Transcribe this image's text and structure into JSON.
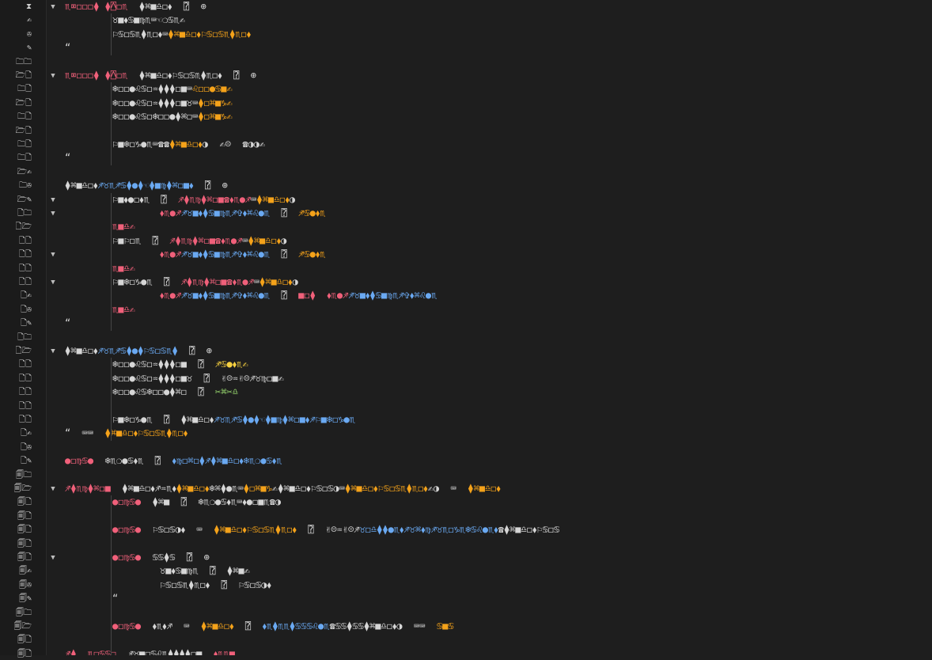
{
  "colors": {
    "background": "#1e1e1e",
    "red": "#f0607a",
    "orange": "#f4a21a",
    "blue": "#6aa9f2",
    "white": "#d6d6d6",
    "yellow": "#f6d040",
    "green": "#9bdd70"
  },
  "gutter": [
    {
      "glyph": "⧗",
      "fold": "▼"
    },
    {
      "glyph": "✍"
    },
    {
      "glyph": "✇"
    },
    {
      "glyph": "✎"
    },
    {
      "glyph": "🗀🗀"
    },
    {
      "glyph": "🗁🗋",
      "fold": "▼"
    },
    {
      "glyph": "🗀🗋"
    },
    {
      "glyph": "🗁🗋"
    },
    {
      "glyph": "🗀🗋"
    },
    {
      "glyph": "🗁🗋"
    },
    {
      "glyph": "🗀🗋"
    },
    {
      "glyph": "🗀🗋"
    },
    {
      "glyph": "🗁✍"
    },
    {
      "glyph": "🗀✇"
    },
    {
      "glyph": "🗁✎",
      "fold": "▼"
    },
    {
      "glyph": "🗋🗀",
      "fold": "▼"
    },
    {
      "glyph": "🗋🗁"
    },
    {
      "glyph": "🗋🗋"
    },
    {
      "glyph": "🗋🗋",
      "fold": "▼"
    },
    {
      "glyph": "🗋🗋"
    },
    {
      "glyph": "🗋🗋",
      "fold": "▼"
    },
    {
      "glyph": "🗋✍"
    },
    {
      "glyph": "🗋✇"
    },
    {
      "glyph": "🗋✎"
    },
    {
      "glyph": "🗋🗀"
    },
    {
      "glyph": "🗋🗁",
      "fold": "▼"
    },
    {
      "glyph": "🗋🗋"
    },
    {
      "glyph": "🗋🗋"
    },
    {
      "glyph": "🗋🗋"
    },
    {
      "glyph": "🗋🗋"
    },
    {
      "glyph": "🗋🗋"
    },
    {
      "glyph": "🗋✍"
    },
    {
      "glyph": "🗋✇"
    },
    {
      "glyph": "🗋✎"
    },
    {
      "glyph": "🗐🗀"
    },
    {
      "glyph": "🗐🗁",
      "fold": "▼"
    },
    {
      "glyph": "🗐🗋"
    },
    {
      "glyph": "🗐🗋"
    },
    {
      "glyph": "🗐🗋"
    },
    {
      "glyph": "🗐🗋"
    },
    {
      "glyph": "🗐🗋",
      "fold": "▼"
    },
    {
      "glyph": "🗐✍"
    },
    {
      "glyph": "🗐✇"
    },
    {
      "glyph": "🗐✎"
    },
    {
      "glyph": "🗐🗀"
    },
    {
      "glyph": "🗐🗁"
    },
    {
      "glyph": "🗐🗋"
    },
    {
      "glyph": "🗐🗋"
    }
  ],
  "lines": [
    {
      "indent": 0,
      "tokens": [
        [
          "red",
          "♏︎⌧︎◻︎◻︎◻︎⧫︎ ⧫︎⍓︎◻︎♏︎"
        ],
        [
          "white",
          "  ⧫︎⌘︎■︎♎︎◻︎⬧︎  ⍰︎  ⊕︎"
        ]
      ]
    },
    {
      "indent": 1,
      "tokens": [
        [
          "white",
          "♉︎■︎⬧︎♋︎■︎♍︎♏︎⌨︎☜︎❍︎♋︎♏︎✍︎"
        ]
      ]
    },
    {
      "indent": 1,
      "tokens": [
        [
          "white",
          "⚐︎♋︎◻︎♋︎♏︎⧫︎♏︎◻︎⬧︎⌨︎"
        ],
        [
          "orange",
          "⧫︎⌘︎■︎♎︎◻︎⬧︎⚐︎♋︎◻︎♋︎♏︎⧫︎♏︎◻︎⬧︎"
        ]
      ]
    },
    {
      "indent": 0,
      "tokens": [
        [
          "white",
          "“"
        ]
      ]
    },
    {
      "indent": 0,
      "tokens": []
    },
    {
      "indent": 0,
      "tokens": [
        [
          "red",
          "♏︎⌧︎◻︎◻︎◻︎⧫︎ ⧫︎⍓︎◻︎♏︎"
        ],
        [
          "white",
          "  ⧫︎⌘︎■︎♎︎◻︎⬧︎⚐︎♋︎◻︎♋︎♏︎⧫︎♏︎◻︎⬧︎  ⍰︎  ⊕︎"
        ]
      ]
    },
    {
      "indent": 1,
      "tokens": [
        [
          "white",
          "❄︎◻︎◻︎●︎♌︎♋︎◻︎♒︎⧫︎⧫︎⧫︎◻︎■︎⌨︎"
        ],
        [
          "orange",
          "♌︎◻︎◻︎●︎♋︎■︎✍︎"
        ]
      ]
    },
    {
      "indent": 1,
      "tokens": [
        [
          "white",
          "❄︎◻︎◻︎●︎♌︎♋︎◻︎♒︎⧫︎⧫︎⧫︎◻︎■︎♉︎⌨︎"
        ],
        [
          "orange",
          "⧫︎◻︎⌘︎■︎♑︎✍︎"
        ]
      ]
    },
    {
      "indent": 1,
      "tokens": [
        [
          "white",
          "❄︎◻︎◻︎●︎♌︎♋︎◻︎❄︎◻︎◻︎●︎⧫︎⌘︎◻︎⌨︎"
        ],
        [
          "orange",
          "⧫︎◻︎⌘︎■︎♑︎✍︎"
        ]
      ]
    },
    {
      "indent": 1,
      "tokens": []
    },
    {
      "indent": 1,
      "tokens": [
        [
          "white",
          "⚐︎■︎❄︎◻︎♑︎●︎♏︎⌨︎☎︎☎︎"
        ],
        [
          "orange",
          "⧫︎⌘︎■︎♎︎◻︎⬧︎"
        ],
        [
          "white",
          "◑︎  ✍︎☹︎  ☎︎◑︎◑︎✍︎"
        ]
      ]
    },
    {
      "indent": 0,
      "tokens": [
        [
          "white",
          "“"
        ]
      ]
    },
    {
      "indent": 0,
      "tokens": []
    },
    {
      "indent": 0,
      "tokens": [
        [
          "white",
          "⧫︎⌘︎■︎♎︎◻︎⬧︎"
        ],
        [
          "blue",
          "♐︎♉︎♏︎♐︎♋︎⧫︎●︎⧫︎☜︎⧫︎■︎♍︎⧫︎⌘︎◻︎■︎⬧︎"
        ],
        [
          "white",
          "  ⍰︎  ⊕︎"
        ]
      ]
    },
    {
      "indent": 1,
      "tokens": [
        [
          "white",
          "⚐︎■︎⬧︎●︎◻︎⬧︎♏︎  ⍰︎  "
        ],
        [
          "red",
          "♐︎⧫︎♏︎♍︎⧫︎⌘︎◻︎■︎☎︎⬧︎♏︎●︎♐︎"
        ],
        [
          "white",
          "⌨︎"
        ],
        [
          "orange",
          "⧫︎⌘︎■︎♎︎◻︎⬧︎"
        ],
        [
          "white",
          "◑︎"
        ]
      ]
    },
    {
      "indent": 2,
      "tokens": [
        [
          "red",
          "⬧︎♏︎●︎♐︎"
        ],
        [
          "blue",
          "♐︎♉︎■︎⬧︎⧫︎♋︎■︎♍︎♏︎♐︎✞︎⬧︎⌘︎♌︎●︎♏︎"
        ],
        [
          "white",
          "  ⍰︎  "
        ],
        [
          "orange",
          "♐︎♋︎●︎⬧︎♏︎"
        ]
      ]
    },
    {
      "indent": 1,
      "tokens": [
        [
          "red",
          "♏︎■︎♎︎✍︎"
        ]
      ]
    },
    {
      "indent": 1,
      "tokens": [
        [
          "white",
          "⚐︎■︎⚐︎◻︎♏︎  ⍰︎  "
        ],
        [
          "red",
          "♐︎⧫︎♏︎♍︎⧫︎⌘︎◻︎■︎☎︎⬧︎♏︎●︎♐︎"
        ],
        [
          "white",
          "⌨︎"
        ],
        [
          "orange",
          "⧫︎⌘︎■︎♎︎◻︎⬧︎"
        ],
        [
          "white",
          "◑︎"
        ]
      ]
    },
    {
      "indent": 2,
      "tokens": [
        [
          "red",
          "⬧︎♏︎●︎♐︎"
        ],
        [
          "blue",
          "♐︎♉︎■︎⬧︎⧫︎♋︎■︎♍︎♏︎♐︎✞︎⬧︎⌘︎♌︎●︎♏︎"
        ],
        [
          "white",
          "  ⍰︎  "
        ],
        [
          "orange",
          "♐︎♋︎●︎⬧︎♏︎"
        ]
      ]
    },
    {
      "indent": 1,
      "tokens": [
        [
          "red",
          "♏︎■︎♎︎✍︎"
        ]
      ]
    },
    {
      "indent": 1,
      "tokens": [
        [
          "white",
          "⚐︎■︎❄︎◻︎♑︎●︎♏︎  ⍰︎  "
        ],
        [
          "red",
          "♐︎⧫︎♏︎♍︎⧫︎⌘︎◻︎■︎☎︎⬧︎♏︎●︎♐︎"
        ],
        [
          "white",
          "⌨︎"
        ],
        [
          "orange",
          "⧫︎⌘︎■︎♎︎◻︎⬧︎"
        ],
        [
          "white",
          "◑︎"
        ]
      ]
    },
    {
      "indent": 2,
      "tokens": [
        [
          "red",
          "⬧︎♏︎●︎♐︎"
        ],
        [
          "blue",
          "♐︎♉︎■︎⬧︎⧫︎♋︎■︎♍︎♏︎♐︎✞︎⬧︎⌘︎♌︎●︎♏︎"
        ],
        [
          "white",
          "  ⍰︎  "
        ],
        [
          "red",
          "■︎◻︎⧫︎  ⬧︎♏︎●︎♐︎"
        ],
        [
          "blue",
          "♐︎♉︎■︎⬧︎⧫︎♋︎■︎♍︎♏︎♐︎✞︎⬧︎⌘︎♌︎●︎♏︎"
        ]
      ]
    },
    {
      "indent": 1,
      "tokens": [
        [
          "red",
          "♏︎■︎♎︎✍︎"
        ]
      ]
    },
    {
      "indent": 0,
      "tokens": [
        [
          "white",
          "“"
        ]
      ]
    },
    {
      "indent": 0,
      "tokens": []
    },
    {
      "indent": 0,
      "tokens": [
        [
          "white",
          "⧫︎⌘︎■︎♎︎◻︎⬧︎"
        ],
        [
          "blue",
          "♐︎♉︎♏︎♐︎♋︎⧫︎●︎⧫︎⚐︎♋︎◻︎♋︎♏︎⧫︎"
        ],
        [
          "white",
          "  ⍰︎  ⊕︎"
        ]
      ]
    },
    {
      "indent": 1,
      "tokens": [
        [
          "white",
          "❄︎◻︎◻︎●︎♌︎♋︎◻︎♒︎⧫︎⧫︎⧫︎◻︎■︎  ⍰︎  "
        ],
        [
          "yellow",
          "♐︎♋︎●︎⬧︎♏︎✍︎"
        ]
      ]
    },
    {
      "indent": 1,
      "tokens": [
        [
          "white",
          "❄︎◻︎◻︎●︎♌︎♋︎◻︎♒︎⧫︎⧫︎⧫︎◻︎■︎♉︎  ⍰︎  ✌︎☹︎♒︎✌︎☹︎♐︎♉︎♍︎◻︎■︎✍︎"
        ]
      ]
    },
    {
      "indent": 1,
      "tokens": [
        [
          "white",
          "❄︎◻︎◻︎●︎♌︎♋︎❄︎◻︎◻︎●︎⧫︎⌘︎◻︎  ⍰︎  "
        ],
        [
          "green",
          "✂︎⌘︎✂︎♎︎"
        ]
      ]
    },
    {
      "indent": 1,
      "tokens": []
    },
    {
      "indent": 1,
      "tokens": [
        [
          "white",
          "⚐︎■︎❄︎◻︎♑︎●︎♏︎  ⍰︎  ⧫︎⌘︎■︎♎︎◻︎⬧︎"
        ],
        [
          "blue",
          "♐︎♉︎♏︎♐︎♋︎⧫︎●︎⧫︎☜︎⧫︎■︎♍︎⧫︎⌘︎◻︎■︎⬧︎♐︎⚐︎■︎❄︎◻︎♑︎●︎♏︎"
        ]
      ]
    },
    {
      "indent": 0,
      "tokens": [
        [
          "white",
          "“  ⌨︎⌨︎  "
        ],
        [
          "orange",
          "⧫︎⌘︎■︎♎︎◻︎⬧︎⚐︎♋︎◻︎♋︎♏︎⧫︎♏︎◻︎⬧︎"
        ]
      ]
    },
    {
      "indent": 0,
      "tokens": []
    },
    {
      "indent": 0,
      "tokens": [
        [
          "red",
          "●︎◻︎♍︎♋︎●︎"
        ],
        [
          "white",
          "  ❄︎♏︎❍︎●︎♋︎⬧︎♏︎  ⍰︎  "
        ],
        [
          "blue",
          "⬧︎♍︎◻︎⌘︎◻︎⧫︎♐︎⧫︎⌘︎■︎♎︎◻︎⬧︎❄︎♏︎❍︎●︎♋︎⬧︎♏︎"
        ]
      ]
    },
    {
      "indent": 0,
      "tokens": []
    },
    {
      "indent": 0,
      "tokens": [
        [
          "red",
          "♐︎⧫︎♏︎♍︎⧫︎⌘︎◻︎■︎"
        ],
        [
          "white",
          "  ⧫︎⌘︎■︎♎︎◻︎⬧︎♐︎♒︎♏︎⬧︎"
        ],
        [
          "orange",
          "⧫︎⌘︎■︎♎︎◻︎⬧︎"
        ],
        [
          "white",
          "❄︎⌘︎⧫︎●︎♏︎⌨︎"
        ],
        [
          "orange",
          "⧫︎◻︎⌘︎■︎♑︎"
        ],
        [
          "white",
          "✍︎⧫︎⌘︎■︎♎︎◻︎⬧︎⚐︎♋︎◻︎♋︎◑︎⌨︎"
        ],
        [
          "orange",
          "⧫︎⌘︎■︎♎︎◻︎⬧︎⚐︎♋︎◻︎♋︎♏︎⧫︎♏︎◻︎⬧︎"
        ],
        [
          "white",
          "✍︎◑︎  ⌨︎  "
        ],
        [
          "orange",
          "⧫︎⌘︎■︎♎︎◻︎⬧︎"
        ]
      ]
    },
    {
      "indent": 1,
      "tokens": [
        [
          "red",
          "●︎◻︎♍︎♋︎●︎"
        ],
        [
          "white",
          "  ⧫︎⌘︎■︎  ⍰︎  ❄︎♏︎❍︎●︎♋︎⬧︎♏︎⌨︎⬧︎●︎◻︎■︎♏︎☎︎◑︎"
        ]
      ]
    },
    {
      "indent": 1,
      "tokens": []
    },
    {
      "indent": 1,
      "tokens": [
        [
          "red",
          "●︎◻︎♍︎♋︎●︎"
        ],
        [
          "white",
          "  ⚐︎♋︎◻︎♋︎◑︎⬧︎  ⌨︎  "
        ],
        [
          "orange",
          "⧫︎⌘︎■︎♎︎◻︎⬧︎⚐︎♋︎◻︎♋︎♏︎⧫︎♏︎◻︎⬧︎"
        ],
        [
          "white",
          "  ⍰︎  ✌︎☹︎♒︎✌︎☹︎♐︎"
        ],
        [
          "blue",
          "♉︎◻︎♎︎⧫︎⧫︎●︎♏︎⬧︎♐︎♉︎⌘︎⬧︎♍︎♐︎♉︎♏︎◻︎♑︎♏︎❄︎♋︎♌︎●︎♏︎⬧︎"
        ],
        [
          "white",
          "☎︎⧫︎⌘︎■︎♎︎◻︎⬧︎⚐︎♋︎◻︎♋︎"
        ]
      ]
    },
    {
      "indent": 1,
      "tokens": []
    },
    {
      "indent": 1,
      "tokens": [
        [
          "red",
          "●︎◻︎♍︎♋︎●︎"
        ],
        [
          "white",
          "  ♋︎♋︎⧫︎♋︎  ⍰︎  ⊕︎"
        ]
      ]
    },
    {
      "indent": 2,
      "tokens": [
        [
          "white",
          "♉︎■︎⬧︎♋︎■︎♍︎♏︎  ⍰︎  ⧫︎⌘︎■︎✍︎"
        ]
      ]
    },
    {
      "indent": 2,
      "tokens": [
        [
          "white",
          "⚐︎♋︎◻︎♋︎♏︎⧫︎♏︎◻︎⬧︎  ⍰︎  ⚐︎♋︎◻︎♋︎◑︎⬧︎"
        ]
      ]
    },
    {
      "indent": 1,
      "tokens": [
        [
          "white",
          "“"
        ]
      ]
    },
    {
      "indent": 1,
      "tokens": []
    },
    {
      "indent": 1,
      "tokens": [
        [
          "red",
          "●︎◻︎♍︎♋︎●︎"
        ],
        [
          "white",
          "  ⬧︎♏︎⬧︎♐︎  ⌨︎  "
        ],
        [
          "orange",
          "⧫︎⌘︎■︎♎︎◻︎⬧︎"
        ],
        [
          "white",
          "  ⍰︎  "
        ],
        [
          "blue",
          "⬧︎♏︎⧫︎♏︎♏︎⧫︎♋︎♋︎♋︎♌︎●︎♏︎"
        ],
        [
          "white",
          "☎︎♋︎♋︎⧫︎♋︎♋︎⧫︎⌘︎■︎♎︎◻︎⬧︎◑︎  ⌨︎⌨︎  "
        ],
        [
          "orange",
          "♋︎■︎♋︎"
        ]
      ]
    },
    {
      "indent": 0,
      "tokens": []
    },
    {
      "indent": 0,
      "tokens": [
        [
          "red",
          "♐︎⧫︎  ♏︎◻︎♋︎♋︎◻︎"
        ],
        [
          "white",
          "  ♐︎♉︎■︎◻︎♋︎♌︎♏︎⧫︎⧫︎⧫︎⧫︎◻︎■︎  "
        ],
        [
          "red",
          "⬧︎♏︎♏︎■︎"
        ]
      ]
    }
  ]
}
